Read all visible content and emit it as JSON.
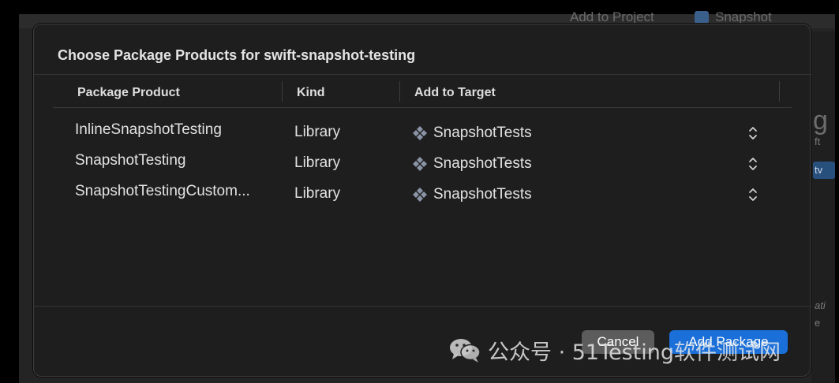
{
  "background": {
    "top_left_text": "Add to Project",
    "top_right_text": "Snapshot",
    "right_panel_letter": "g",
    "right_panel_ft": "ft",
    "right_panel_tv": "tv",
    "right_panel_ati": "ati",
    "right_panel_e": "e"
  },
  "sheet": {
    "title": "Choose Package Products for swift-snapshot-testing",
    "columns": {
      "product": "Package Product",
      "kind": "Kind",
      "target": "Add to Target"
    },
    "rows": [
      {
        "product": "InlineSnapshotTesting",
        "kind": "Library",
        "target": "SnapshotTests",
        "target_icon": "target-icon"
      },
      {
        "product": "SnapshotTesting",
        "kind": "Library",
        "target": "SnapshotTests",
        "target_icon": "target-icon"
      },
      {
        "product": "SnapshotTestingCustom...",
        "kind": "Library",
        "target": "SnapshotTests",
        "target_icon": "target-icon"
      }
    ],
    "buttons": {
      "cancel": "Cancel",
      "add": "Add Package"
    }
  },
  "watermark": {
    "text": "公众号 · 51Testing软件测试网",
    "icon": "wechat-icon"
  },
  "colors": {
    "accent": "#1b6fd8",
    "sheet_bg": "#1e1e1e",
    "text": "#e2e2e2"
  }
}
